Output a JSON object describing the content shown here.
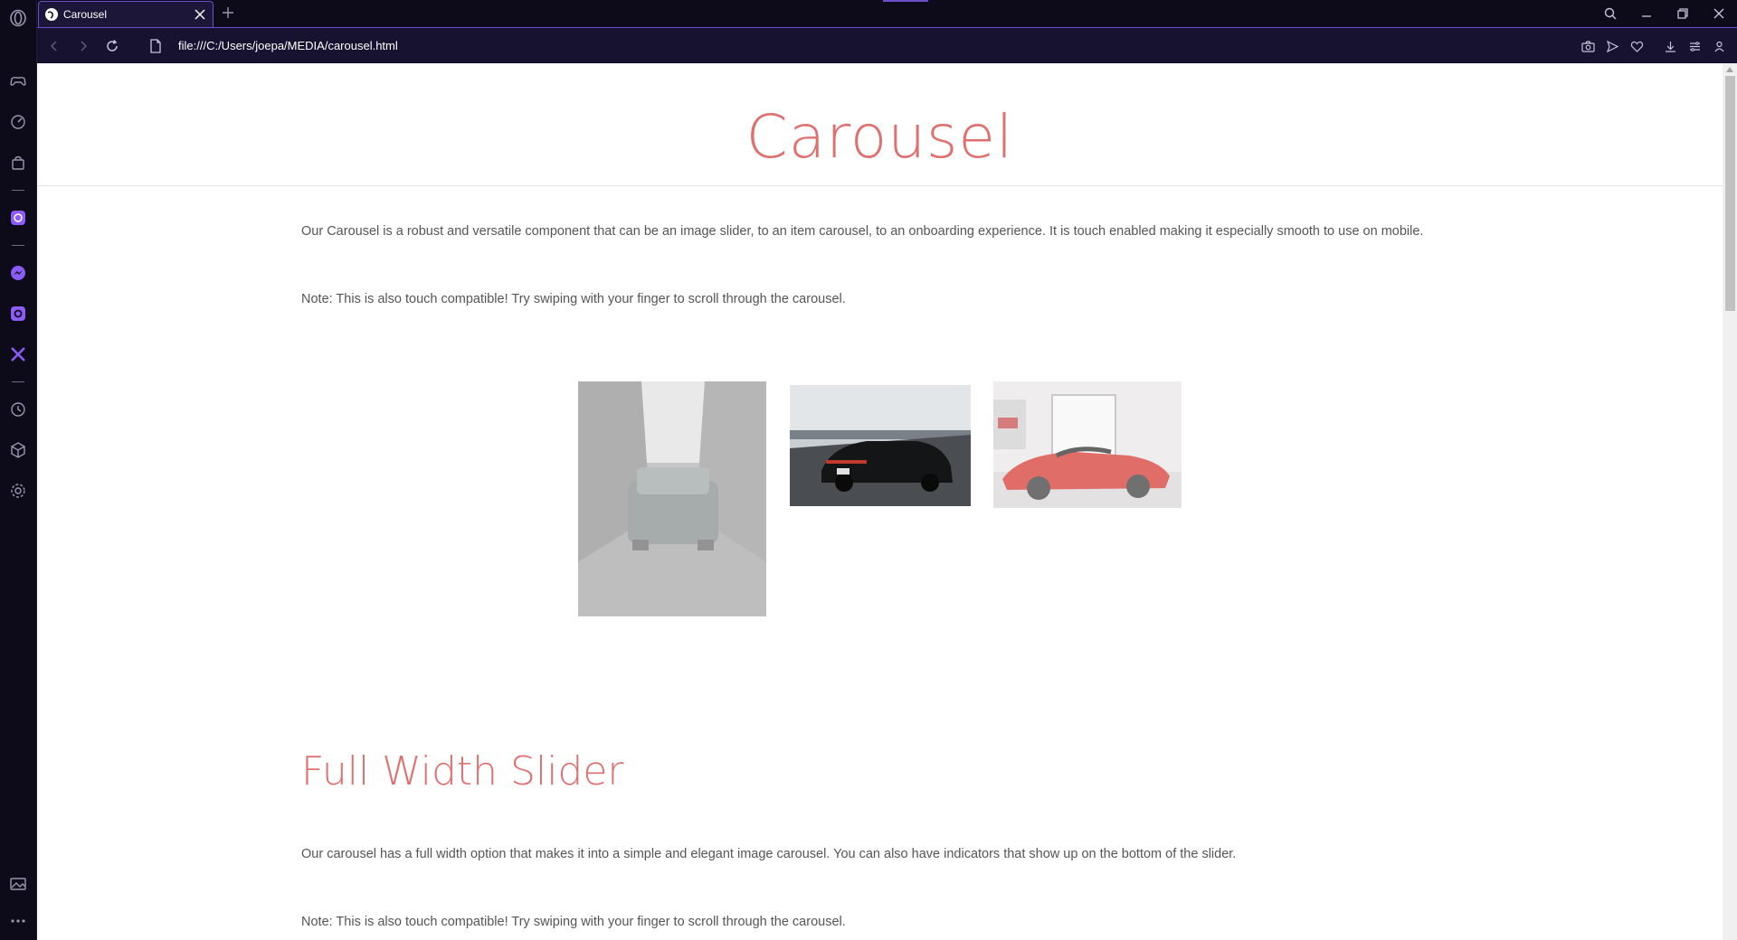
{
  "browser": {
    "tab": {
      "title": "Carousel"
    },
    "url": "file:///C:/Users/joepa/MEDIA/carousel.html"
  },
  "sidebar": {
    "items": [
      {
        "icon": "opera-logo-icon"
      },
      {
        "icon": "gamepad-icon"
      },
      {
        "icon": "speed-dial-icon"
      },
      {
        "icon": "shopping-icon"
      },
      {
        "icon": "aria-icon"
      },
      {
        "icon": "messenger-icon"
      },
      {
        "icon": "instagram-icon"
      },
      {
        "icon": "x-twitter-icon"
      },
      {
        "icon": "history-icon"
      },
      {
        "icon": "extensions-icon"
      },
      {
        "icon": "settings-icon"
      },
      {
        "icon": "gallery-icon"
      },
      {
        "icon": "more-icon"
      }
    ]
  },
  "page": {
    "title": "Carousel",
    "intro": "Our Carousel is a robust and versatile component that can be an image slider, to an item carousel, to an onboarding experience. It is touch enabled making it especially smooth to use on mobile.",
    "note1": "Note: This is also touch compatible! Try swiping with your finger to scroll through the carousel.",
    "carousel_items": [
      {
        "image": "grey-sports-car-street",
        "active": false
      },
      {
        "image": "black-porsche-road",
        "active": true
      },
      {
        "image": "red-ferrari-garage",
        "active": false
      }
    ],
    "section_title": "Full Width Slider",
    "section_text": "Our carousel has a full width option that makes it into a simple and elegant image carousel. You can also have indicators that show up on the bottom of the slider.",
    "note2": "Note: This is also touch compatible! Try swiping with your finger to scroll through the carousel."
  },
  "colors": {
    "accent": "#e07070",
    "browser_accent": "#6a4ecb",
    "sidebar_bg": "#0d0b1a",
    "text": "#555555"
  }
}
